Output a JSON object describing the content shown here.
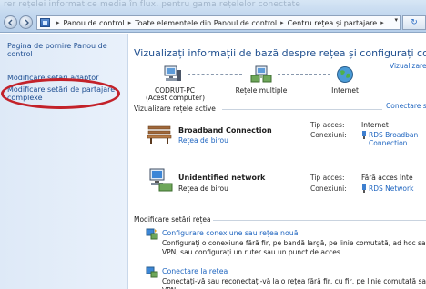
{
  "topbar": {
    "blurred_text": "rer rețelei informatice media în flux, pentru gama rețelelor conectate",
    "breadcrumb": [
      "Panou de control",
      "Toate elementele din Panoul de control",
      "Centru rețea și partajare"
    ]
  },
  "sidebar": {
    "items": [
      {
        "label": "Pagina de pornire Panou de control"
      },
      {
        "label": "Modificare setări adaptor"
      },
      {
        "label": "Modificare setări de partajare complexe"
      }
    ]
  },
  "main": {
    "title": "Vizualizați informații de bază despre rețea și configurați conexiunile",
    "full_map_link": "Vizualizare h",
    "map": {
      "computer_name": "CODRUT-PC",
      "computer_sub": "(Acest computer)",
      "network_label": "Rețele multiple",
      "internet_label": "Internet"
    },
    "active_header": "Vizualizare rețele active",
    "connect_link": "Conectare sau",
    "networks": [
      {
        "name": "Broadband Connection",
        "type": "Rețea de birou",
        "access_label": "Tip acces:",
        "access_value": "Internet",
        "conn_label": "Conexiuni:",
        "conn_value": "RDS Broadban Connection"
      },
      {
        "name": "Unidentified network",
        "type": "Rețea de birou",
        "access_label": "Tip acces:",
        "access_value": "Fără acces Inte",
        "conn_label": "Conexiuni:",
        "conn_value": "RDS Network"
      }
    ],
    "settings_header": "Modificare setări rețea",
    "tasks": [
      {
        "title": "Configurare conexiune sau rețea nouă",
        "desc": "Configurați o conexiune fără fir, pe bandă largă, pe linie comutată, ad hoc sau VPN; sau configurați un ruter sau un punct de acces."
      },
      {
        "title": "Conectare la rețea",
        "desc": "Conectați-vă sau reconectați-vă la o rețea fără fir, cu fir, pe linie comutată sau VPN."
      }
    ]
  },
  "colors": {
    "link": "#2066c0",
    "title": "#1f4f8f",
    "highlight_ellipse": "#c3222a",
    "sidebar_bg": "#e3edf9"
  }
}
